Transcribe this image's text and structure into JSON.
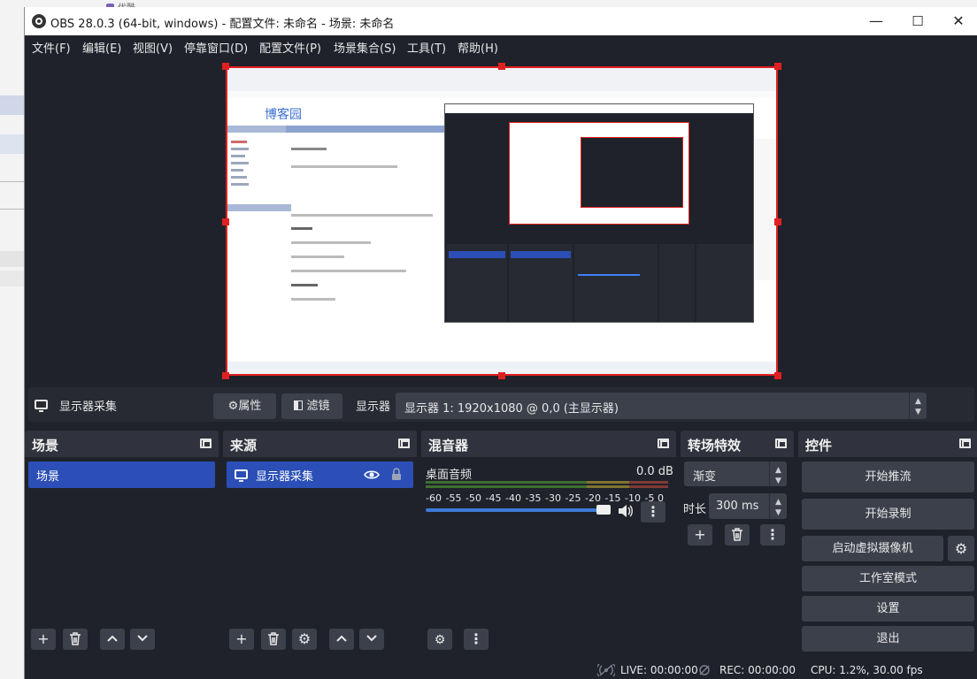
{
  "desktop": {
    "tab_label": "优酷"
  },
  "window": {
    "title": "OBS 28.0.3 (64-bit, windows) - 配置文件: 未命名 - 场景: 未命名",
    "controls": {
      "minimize": "—",
      "maximize": "☐",
      "close": "✕"
    }
  },
  "menu": {
    "items": [
      "文件(F)",
      "编辑(E)",
      "视图(V)",
      "停靠窗口(D)",
      "配置文件(P)",
      "场景集合(S)",
      "工具(T)",
      "帮助(H)"
    ]
  },
  "preview": {
    "captured_site_title": "博客园"
  },
  "source_toolbar": {
    "source_name": "显示器采集",
    "properties_label": "属性",
    "filters_label": "滤镜",
    "display_label": "显示器",
    "display_value": "显示器 1: 1920x1080 @ 0,0 (主显示器)"
  },
  "scenes": {
    "title": "场景",
    "items": [
      "场景"
    ]
  },
  "sources": {
    "title": "来源",
    "items": [
      "显示器采集"
    ]
  },
  "mixer": {
    "title": "混音器",
    "channel_name": "桌面音频",
    "channel_level": "0.0 dB",
    "ticks": [
      "-60",
      "-55",
      "-50",
      "-45",
      "-40",
      "-35",
      "-30",
      "-25",
      "-20",
      "-15",
      "-10",
      "-5",
      "0"
    ],
    "volume": 1.0
  },
  "transitions": {
    "title": "转场特效",
    "transition": "渐变",
    "duration_label": "时长",
    "duration_value": "300 ms"
  },
  "controls": {
    "title": "控件",
    "start_streaming": "开始推流",
    "start_recording": "开始录制",
    "start_virtual_camera": "启动虚拟摄像机",
    "studio_mode": "工作室模式",
    "settings": "设置",
    "exit": "退出"
  },
  "status": {
    "live": "LIVE: 00:00:00",
    "rec": "REC: 00:00:00",
    "cpu": "CPU: 1.2%, 30.00 fps"
  },
  "colors": {
    "background": "#1f222b",
    "panel": "#272a33",
    "button": "#3c404b",
    "selection": "#2b4fb6",
    "preview_border": "#e02020"
  }
}
